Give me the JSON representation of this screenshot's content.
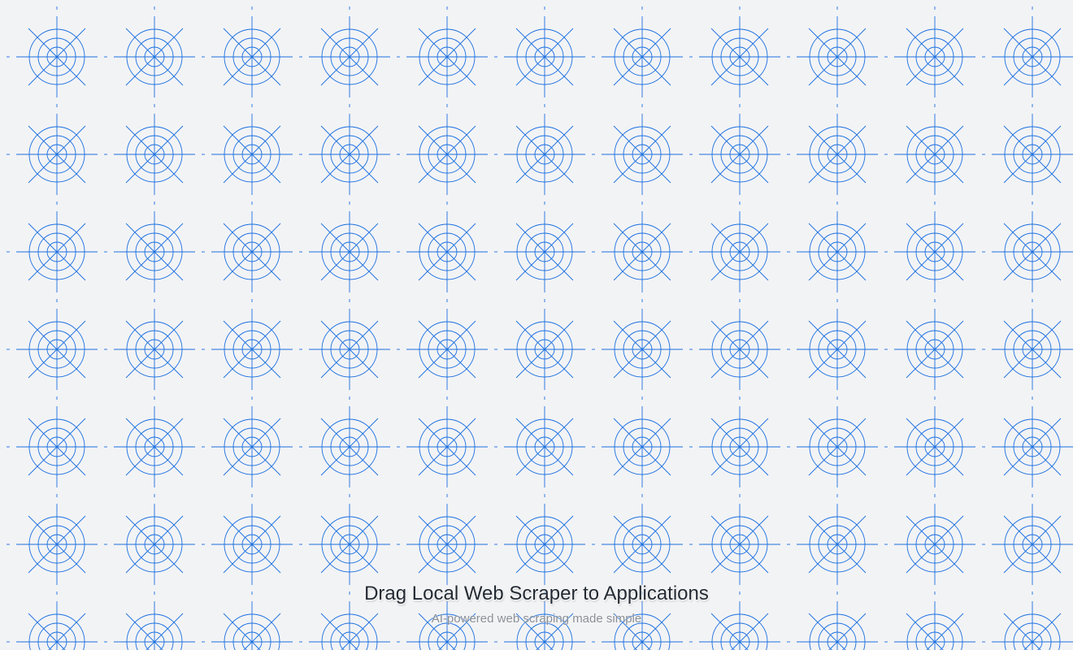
{
  "window": {
    "title": "Drag Local Web Scraper to Applications",
    "subtitle": "AI-powered web scraping made simple"
  },
  "background": {
    "pattern_icon": "web-target-icon",
    "color": "#f2f3f5",
    "line_color": "#1a6fe0"
  }
}
